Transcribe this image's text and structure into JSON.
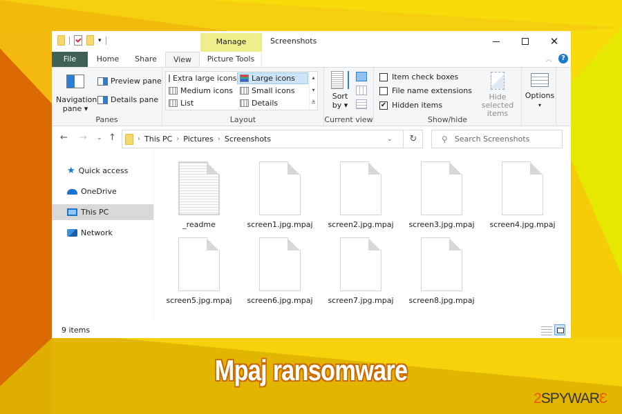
{
  "window": {
    "title": "Screenshots",
    "context_tab": "Manage",
    "controls": {
      "minimize": "minimize",
      "maximize": "maximize",
      "close": "✕"
    },
    "help_label": "?"
  },
  "quick_access_toolbar": {
    "icons": [
      "folder-icon",
      "properties-icon",
      "new-folder-icon"
    ],
    "dropdown": "▾"
  },
  "tabs": [
    {
      "label": "File"
    },
    {
      "label": "Home"
    },
    {
      "label": "Share"
    },
    {
      "label": "View",
      "active": true
    },
    {
      "label": "Picture Tools"
    }
  ],
  "ribbon": {
    "panes": {
      "label": "Panes",
      "navigation_pane": "Navigation",
      "navigation_pane_2": "pane ▾",
      "preview_pane": "Preview pane",
      "details_pane": "Details pane"
    },
    "layout": {
      "label": "Layout",
      "items": [
        {
          "label": "Extra large icons",
          "selected": false
        },
        {
          "label": "Large icons",
          "selected": true
        },
        {
          "label": "Medium icons",
          "selected": false
        },
        {
          "label": "Small icons",
          "selected": false
        },
        {
          "label": "List",
          "selected": false
        },
        {
          "label": "Details",
          "selected": false
        }
      ],
      "scroll": [
        "▴",
        "▾",
        "≚"
      ]
    },
    "current_view": {
      "label": "Current view",
      "sort_by": "Sort",
      "sort_by_2": "by ▾"
    },
    "show_hide": {
      "label": "Show/hide",
      "checkboxes": [
        {
          "label": "Item check boxes",
          "checked": false
        },
        {
          "label": "File name extensions",
          "checked": false
        },
        {
          "label": "Hidden items",
          "checked": true
        }
      ],
      "hide_selected": "Hide selected",
      "hide_selected_2": "items"
    },
    "options": {
      "label": "Options",
      "arrow": "▾"
    }
  },
  "address_bar": {
    "breadcrumbs": [
      "This PC",
      "Pictures",
      "Screenshots"
    ],
    "separator": "›",
    "search_placeholder": "Search Screenshots"
  },
  "sidebar": {
    "items": [
      {
        "label": "Quick access",
        "icon": "star-icon"
      },
      {
        "label": "OneDrive",
        "icon": "cloud-icon"
      },
      {
        "label": "This PC",
        "icon": "computer-icon",
        "selected": true
      },
      {
        "label": "Network",
        "icon": "network-icon"
      }
    ]
  },
  "files": [
    {
      "name": "_readme",
      "type": "text"
    },
    {
      "name": "screen1.jpg.mpaj",
      "type": "blank"
    },
    {
      "name": "screen2.jpg.mpaj",
      "type": "blank"
    },
    {
      "name": "screen3.jpg.mpaj",
      "type": "blank"
    },
    {
      "name": "screen4.jpg.mpaj",
      "type": "blank"
    },
    {
      "name": "screen5.jpg.mpaj",
      "type": "blank"
    },
    {
      "name": "screen6.jpg.mpaj",
      "type": "blank"
    },
    {
      "name": "screen7.jpg.mpaj",
      "type": "blank"
    },
    {
      "name": "screen8.jpg.mpaj",
      "type": "blank"
    }
  ],
  "status_bar": {
    "item_count": "9 items"
  },
  "caption": "Mpaj ransomware",
  "watermark": {
    "part1": "2",
    "part2": "SPYWAR",
    "part3": "Ɛ"
  },
  "colors": {
    "file_tab": "#3f6158",
    "manage_tab": "#eeef8a",
    "accent_blue": "#1a73d1",
    "selected_layout": "#cce4f7",
    "bg_yellow": "#f7d80c",
    "bg_orange": "#dc6a04",
    "bg_gold": "#e2b500"
  }
}
